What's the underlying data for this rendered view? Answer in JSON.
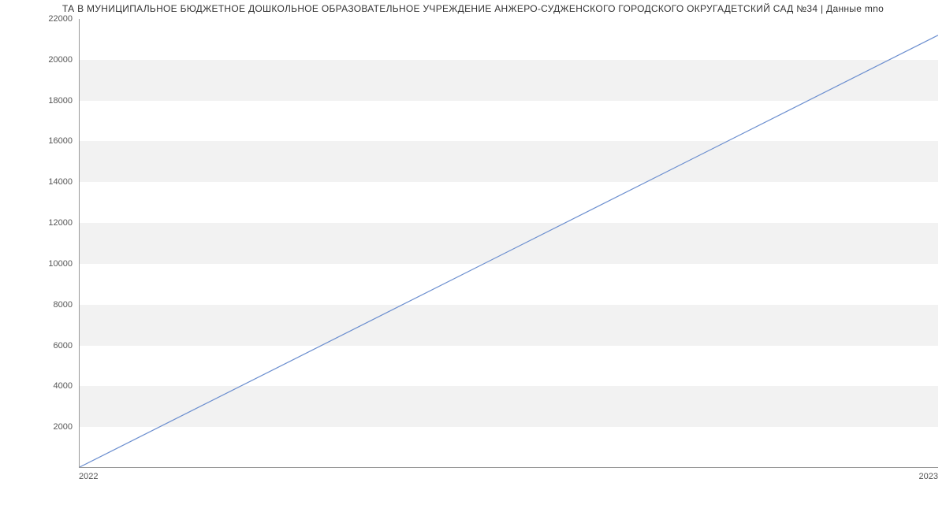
{
  "chart_data": {
    "type": "line",
    "title": "ТА В МУНИЦИПАЛЬНОЕ БЮДЖЕТНОЕ ДОШКОЛЬНОЕ ОБРАЗОВАТЕЛЬНОЕ УЧРЕЖДЕНИЕ АНЖЕРО-СУДЖЕНСКОГО ГОРОДСКОГО ОКРУГАДЕТСКИЙ САД №34  | Данные mno",
    "xlabel": "",
    "ylabel": "",
    "x": [
      "2022",
      "2023"
    ],
    "values": [
      0,
      21200
    ],
    "ylim": [
      0,
      22000
    ],
    "y_ticks": [
      2000,
      4000,
      6000,
      8000,
      10000,
      12000,
      14000,
      16000,
      18000,
      20000,
      22000
    ],
    "x_ticks": [
      "2022",
      "2023"
    ],
    "line_color": "#6b8ecf"
  }
}
